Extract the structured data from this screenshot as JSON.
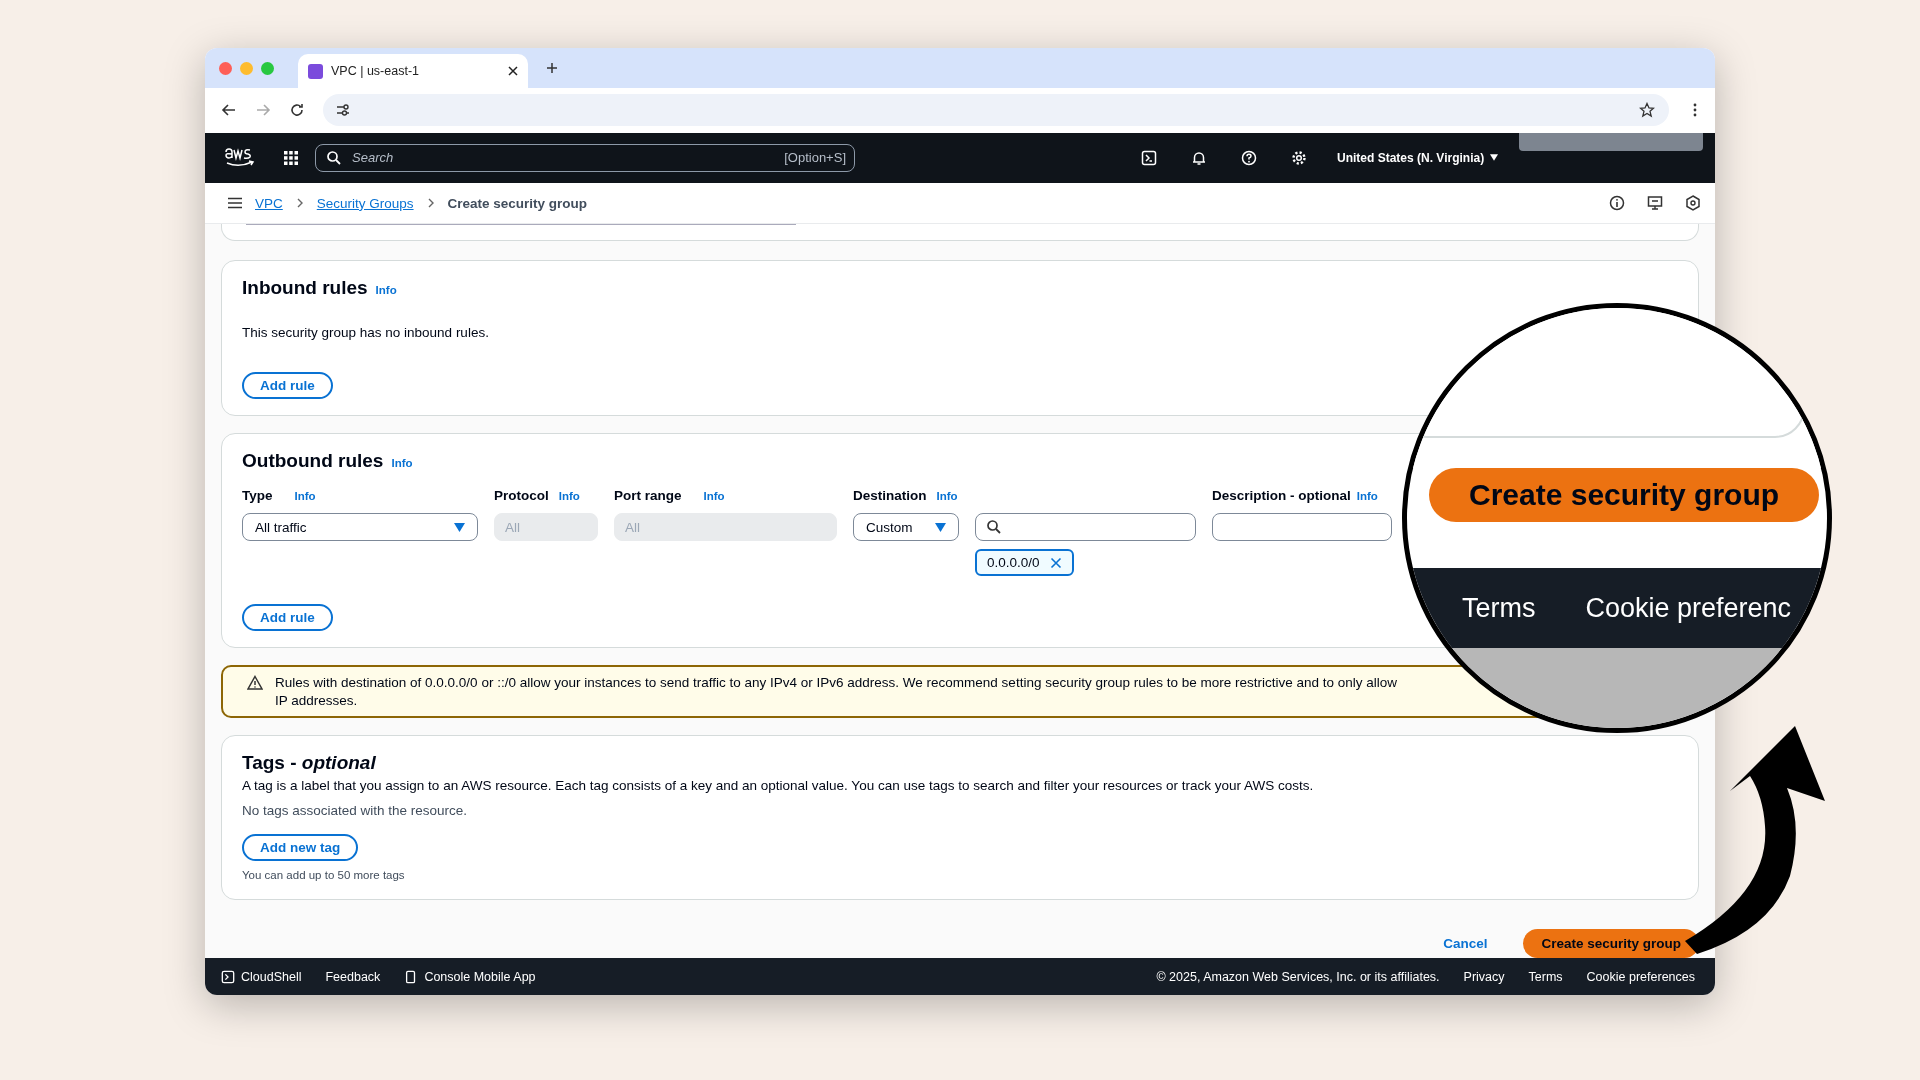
{
  "browser": {
    "tab_title": "VPC | us-east-1"
  },
  "aws_header": {
    "search_placeholder": "Search",
    "shortcut": "[Option+S]",
    "region": "United States (N. Virginia)"
  },
  "breadcrumb": [
    {
      "label": "VPC",
      "link": true
    },
    {
      "label": "Security Groups",
      "link": true
    },
    {
      "label": "Create security group",
      "link": false
    }
  ],
  "inbound": {
    "title": "Inbound rules",
    "info": "Info",
    "message": "This security group has no inbound rules.",
    "add_button": "Add rule"
  },
  "outbound": {
    "title": "Outbound rules",
    "info": "Info",
    "columns": [
      {
        "label": "Type",
        "info": "Info"
      },
      {
        "label": "Protocol",
        "info": "Info"
      },
      {
        "label": "Port range",
        "info": "Info"
      },
      {
        "label": "Destination",
        "info": "Info"
      },
      {
        "label": "Description - optional",
        "info": "Info"
      }
    ],
    "rule": {
      "type": "All traffic",
      "protocol": {
        "value": "All",
        "disabled": true
      },
      "port_range": {
        "value": "All",
        "disabled": true
      },
      "destination_type": "Custom",
      "destination_token": "0.0.0.0/0"
    },
    "add_button": "Add rule"
  },
  "warning": {
    "lines": [
      "Rules with destination of 0.0.0.0/0 or ::/0 allow your instances to send traffic to any IPv4 or IPv6 address. We recommend setting security group rules to be more restrictive and to only allow",
      "IP addresses."
    ]
  },
  "tags": {
    "title": "Tags - *optional*",
    "description": "A tag is a label that you assign to an AWS resource. Each tag consists of a key and an optional value. You can use tags to search and filter your resources or track your AWS costs.",
    "empty_message": "No tags associated with the resource.",
    "add_button": "Add new tag",
    "hint": "You can add up to 50 more tags"
  },
  "actions": {
    "cancel": "Cancel",
    "create": "Create security group"
  },
  "footer": {
    "left": [
      "CloudShell",
      "Feedback",
      "Console Mobile App"
    ],
    "copyright": "© 2025, Amazon Web Services, Inc. or its affiliates.",
    "links": [
      "Privacy",
      "Terms",
      "Cookie preferences"
    ]
  },
  "magnifier": {
    "button": "Create security group",
    "links": [
      "Terms",
      "Cookie preferenc"
    ]
  }
}
